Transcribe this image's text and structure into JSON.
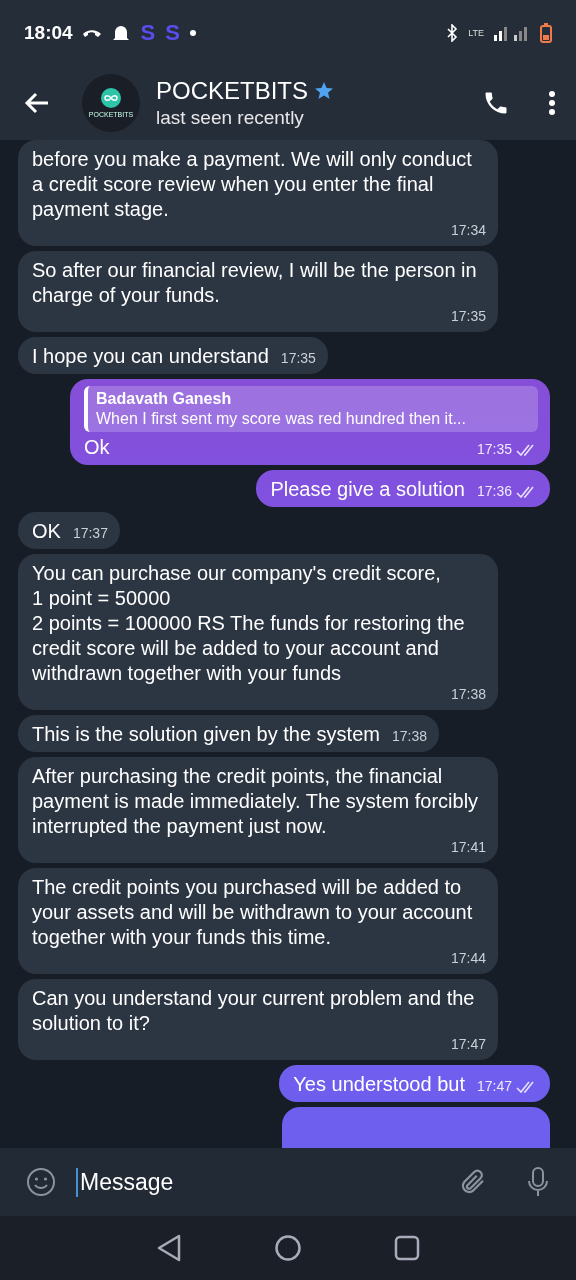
{
  "status_bar": {
    "time": "18:04",
    "app_letters": [
      "S",
      "S"
    ],
    "network": "LTE"
  },
  "header": {
    "name": "POCKETBITS",
    "avatar_text": "POCKETBITS",
    "status": "last seen recently",
    "starred": true
  },
  "messages": [
    {
      "kind": "incoming",
      "text": "before you make a payment. We will only conduct a credit score review when you enter the final payment stage.",
      "time": "17:34"
    },
    {
      "kind": "incoming",
      "text": "So after our financial review, I will be the person in charge of your funds.",
      "time": "17:35"
    },
    {
      "kind": "incoming",
      "text": "I hope you can understand",
      "time": "17:35"
    },
    {
      "kind": "outgoing",
      "reply": {
        "author": "Badavath Ganesh",
        "text": "When I first sent my score was red hundred then it..."
      },
      "text": "Ok",
      "time": "17:35",
      "read": true
    },
    {
      "kind": "outgoing",
      "text": "Please give a solution",
      "time": "17:36",
      "read": true
    },
    {
      "kind": "incoming",
      "text": "OK",
      "time": "17:37"
    },
    {
      "kind": "incoming",
      "text": "You can purchase our company's credit score,\n1 point = 50000\n2 points = 100000 RS The funds for restoring the credit score will be added to your account and withdrawn together with your funds",
      "time": "17:38"
    },
    {
      "kind": "incoming",
      "text": "This is the solution given by the system",
      "time": "17:38"
    },
    {
      "kind": "incoming",
      "text": "After purchasing the credit points, the financial payment is made immediately. The system forcibly interrupted the payment just now.",
      "time": "17:41"
    },
    {
      "kind": "incoming",
      "text": "The credit points you purchased will be added to your assets and will be withdrawn to your account together with your funds this time.",
      "time": "17:44"
    },
    {
      "kind": "incoming",
      "text": "Can you understand your current problem and the solution to it?",
      "time": "17:47"
    },
    {
      "kind": "outgoing",
      "text": "Yes understood but",
      "time": "17:47",
      "read": true
    }
  ],
  "composer": {
    "placeholder": "Message"
  }
}
